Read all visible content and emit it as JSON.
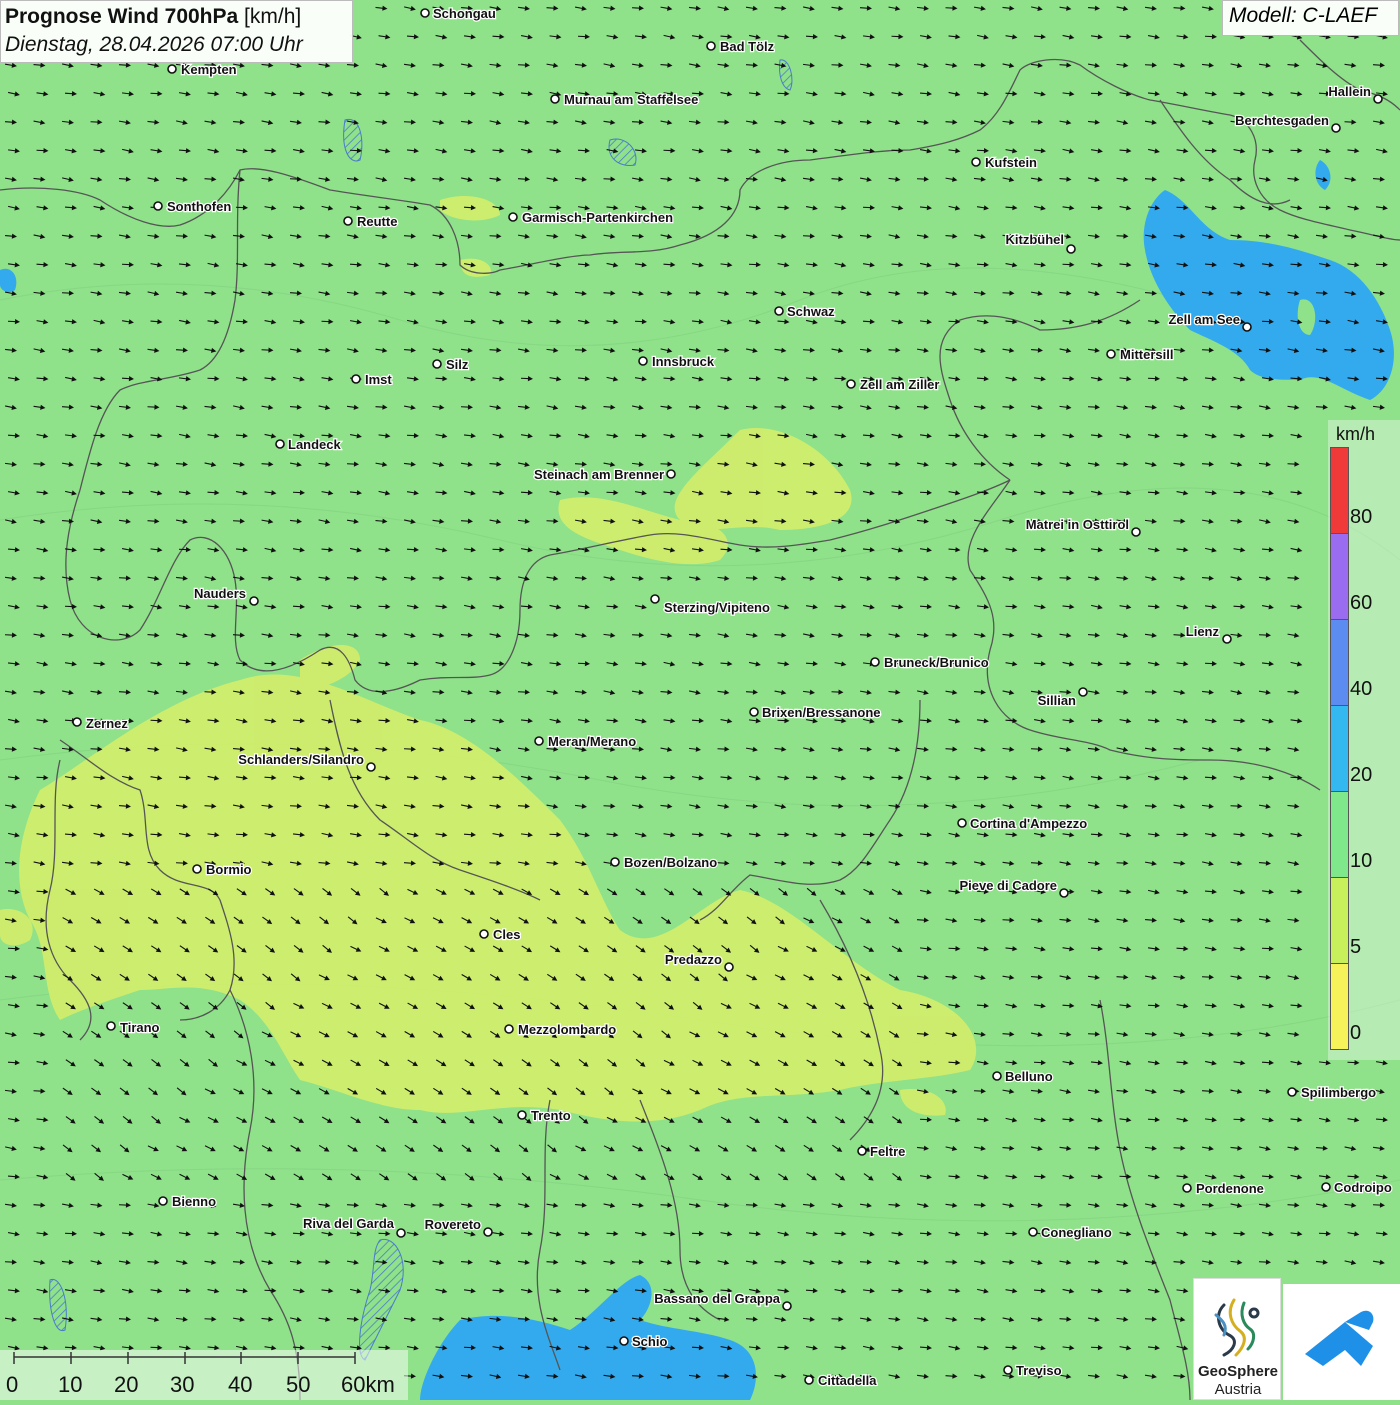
{
  "header": {
    "title_bold": "Prognose Wind 700hPa",
    "title_unit": "[km/h]",
    "datetime": "Dienstag, 28.04.2026 07:00 Uhr"
  },
  "model_label": "Modell: C-LAEF",
  "colors": {
    "background_wind": "#8fe18a",
    "calm_wind": "#d9ee66",
    "strong_wind": "#33aaee",
    "borders": "#555555"
  },
  "legend": {
    "unit": "km/h",
    "labels": [
      "80",
      "60",
      "40",
      "20",
      "10",
      "5",
      "0"
    ],
    "colors": [
      "#f03a3a",
      "#9a6cf0",
      "#5c8cf0",
      "#33b8f0",
      "#7ee88a",
      "#c8f05a",
      "#f6f35a"
    ]
  },
  "scale_bar": {
    "labels": [
      "0",
      "10",
      "20",
      "30",
      "40",
      "50",
      "60km"
    ]
  },
  "logos": {
    "geosphere_line1": "GeoSphere",
    "geosphere_line2": "Austria",
    "geosphere_icon": "geosphere-logo-icon",
    "app_icon": "blue-arrow-logo-icon"
  },
  "cities": [
    {
      "name": "Schongau"
    },
    {
      "name": "Bad Tölz"
    },
    {
      "name": "Kempten"
    },
    {
      "name": "Murnau am Staffelsee"
    },
    {
      "name": "Hallein"
    },
    {
      "name": "Berchtesgaden"
    },
    {
      "name": "Kufstein"
    },
    {
      "name": "Sonthofen"
    },
    {
      "name": "Reutte"
    },
    {
      "name": "Garmisch-Partenkirchen"
    },
    {
      "name": "Kitzbühel"
    },
    {
      "name": "Schwaz"
    },
    {
      "name": "Zell am See"
    },
    {
      "name": "Mittersill"
    },
    {
      "name": "Silz"
    },
    {
      "name": "Innsbruck"
    },
    {
      "name": "Imst"
    },
    {
      "name": "Zell am Ziller"
    },
    {
      "name": "Landeck"
    },
    {
      "name": "Steinach am Brenner"
    },
    {
      "name": "Matrei in Osttirol"
    },
    {
      "name": "Nauders"
    },
    {
      "name": "Sterzing/Vipiteno"
    },
    {
      "name": "Lienz"
    },
    {
      "name": "Bruneck/Brunico"
    },
    {
      "name": "Sillian"
    },
    {
      "name": "Brixen/Bressanone"
    },
    {
      "name": "Zernez"
    },
    {
      "name": "Meran/Merano"
    },
    {
      "name": "Schlanders/Silandro"
    },
    {
      "name": "Cortina d'Ampezzo"
    },
    {
      "name": "Bozen/Bolzano"
    },
    {
      "name": "Bormio"
    },
    {
      "name": "Pieve di Cadore"
    },
    {
      "name": "Cles"
    },
    {
      "name": "Predazzo"
    },
    {
      "name": "Tirano"
    },
    {
      "name": "Mezzolombardo"
    },
    {
      "name": "Belluno"
    },
    {
      "name": "Spilimbergo"
    },
    {
      "name": "Trento"
    },
    {
      "name": "Feltre"
    },
    {
      "name": "Pordenone"
    },
    {
      "name": "Codroipo"
    },
    {
      "name": "Bienno"
    },
    {
      "name": "Riva del Garda"
    },
    {
      "name": "Rovereto"
    },
    {
      "name": "Conegliano"
    },
    {
      "name": "Bassano del Grappa"
    },
    {
      "name": "Schio"
    },
    {
      "name": "Treviso"
    },
    {
      "name": "Cittadella"
    }
  ]
}
